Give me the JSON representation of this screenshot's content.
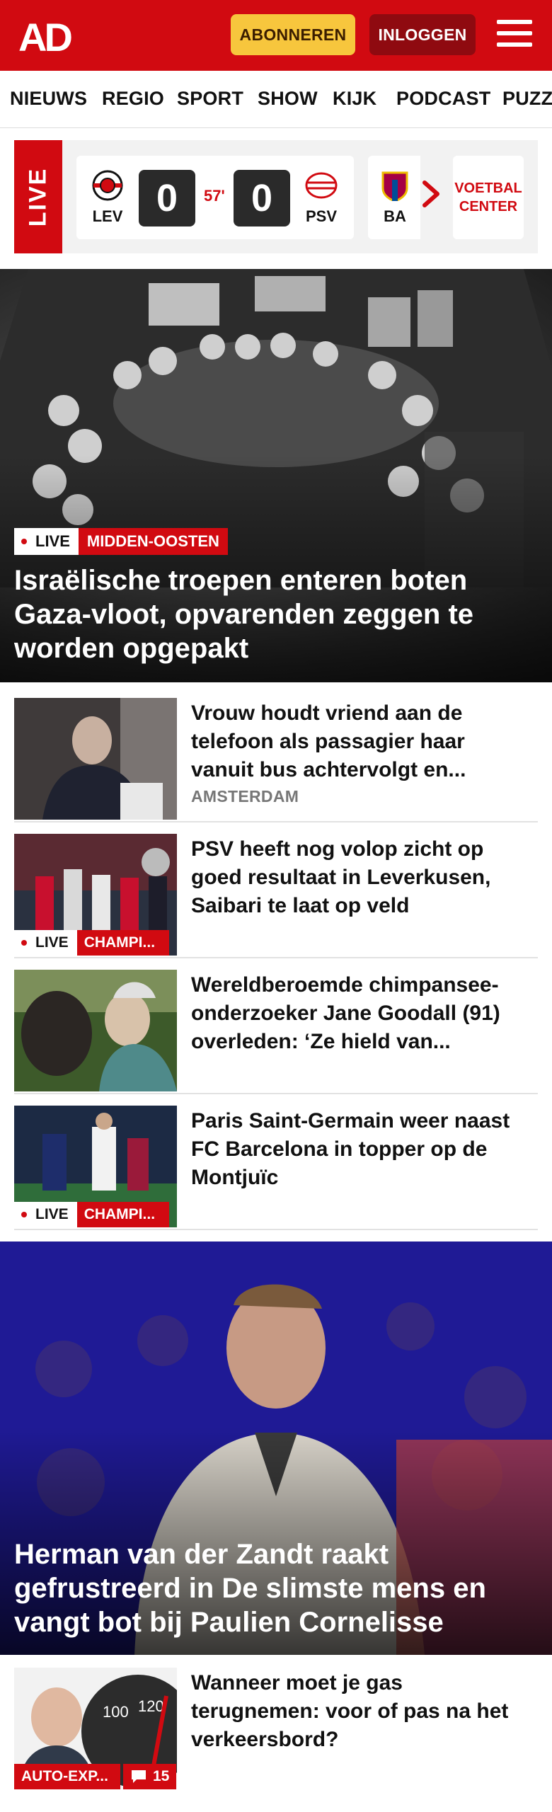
{
  "header": {
    "logo_text": "AD",
    "subscribe_label": "ABONNEREN",
    "login_label": "INLOGGEN"
  },
  "nav": {
    "items": [
      "NIEUWS",
      "REGIO",
      "SPORT",
      "SHOW",
      "KIJK",
      "PODCAST",
      "PUZZ"
    ]
  },
  "live_bar": {
    "label": "LIVE",
    "match": {
      "home_abbr": "LEV",
      "home_score": "0",
      "minute": "57'",
      "away_score": "0",
      "away_abbr": "PSV"
    },
    "next_abbr": "BA",
    "voetbal_center": "VOETBAL CENTER"
  },
  "hero": {
    "live_label": "LIVE",
    "category": "MIDDEN-OOSTEN",
    "title": "Israëlische troepen enteren boten Gaza-vloot, opvarenden zeggen te worden opgepakt"
  },
  "articles": [
    {
      "title": "Vrouw houdt vriend aan de telefoon als passagier haar vanuit bus achtervolgt en...",
      "meta": "AMSTERDAM"
    },
    {
      "title": "PSV heeft nog volop zicht op goed resultaat in Leverkusen, Saibari te laat op veld",
      "live_label": "LIVE",
      "category": "CHAMPI..."
    },
    {
      "title": "Wereldberoemde chimpansee-onderzoeker Jane Goodall (91) overleden: ‘Ze hield van..."
    },
    {
      "title": "Paris Saint-Germain weer naast FC Barcelona in topper op de Montjuïc",
      "live_label": "LIVE",
      "category": "CHAMPI..."
    }
  ],
  "hero2": {
    "title": "Herman van der Zandt raakt gefrustreerd in De slimste mens en vangt bot bij Paulien Cornelisse"
  },
  "article_bottom": {
    "title": "Wanneer moet je gas terugnemen: voor of pas na het verkeersbord?",
    "category": "AUTO-EXP...",
    "comments": "15"
  },
  "colors": {
    "brand_red": "#d10a11",
    "subscribe_yellow": "#f7c63d",
    "login_dark_red": "#8f0a10"
  }
}
